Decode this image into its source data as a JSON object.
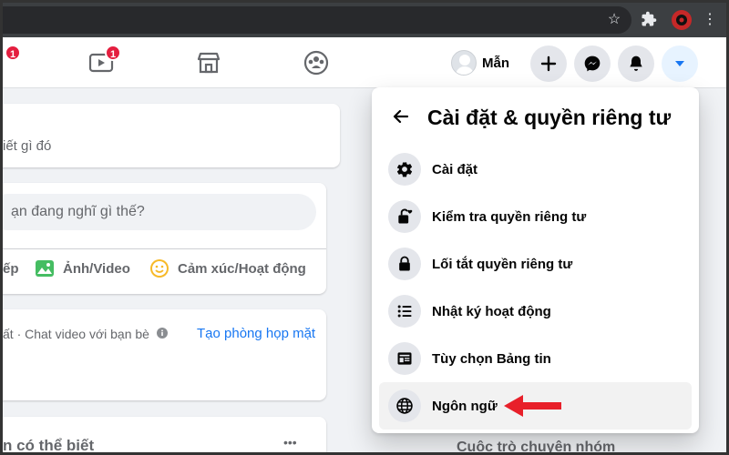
{
  "browser": {
    "icons": [
      "star-icon",
      "extension-icon",
      "profile-icon",
      "menu-icon"
    ]
  },
  "header": {
    "watch_badge": "1",
    "left_badge": "1",
    "profile_name": "Mẫn",
    "accent": "#1877f2"
  },
  "feed": {
    "status_snippet": "iết gì đó",
    "composer_placeholder": "ạn đang nghĩ gì thế?",
    "actions": {
      "live_partial": "ếp",
      "photo_video": "Ảnh/Video",
      "feeling": "Cảm xúc/Hoạt động"
    },
    "rooms": {
      "text": "ất · Chat video với bạn bè",
      "create_link": "Tạo phòng họp mặt"
    },
    "people_heading": "n có thể biết",
    "more_label": "•••"
  },
  "dropdown": {
    "title": "Cài đặt & quyền riêng tư",
    "items": [
      {
        "label": "Cài đặt",
        "icon": "gear-icon"
      },
      {
        "label": "Kiểm tra quyền riêng tư",
        "icon": "lock-heart-icon"
      },
      {
        "label": "Lối tắt quyền riêng tư",
        "icon": "lock-icon"
      },
      {
        "label": "Nhật ký hoạt động",
        "icon": "list-icon"
      },
      {
        "label": "Tùy chọn Bảng tin",
        "icon": "feed-icon"
      },
      {
        "label": "Ngôn ngữ",
        "icon": "globe-icon"
      }
    ]
  },
  "sidebar_right": {
    "group_chat": "Cuộc trò chuyện nhóm"
  },
  "colors": {
    "annotation_arrow": "#e8202a"
  }
}
